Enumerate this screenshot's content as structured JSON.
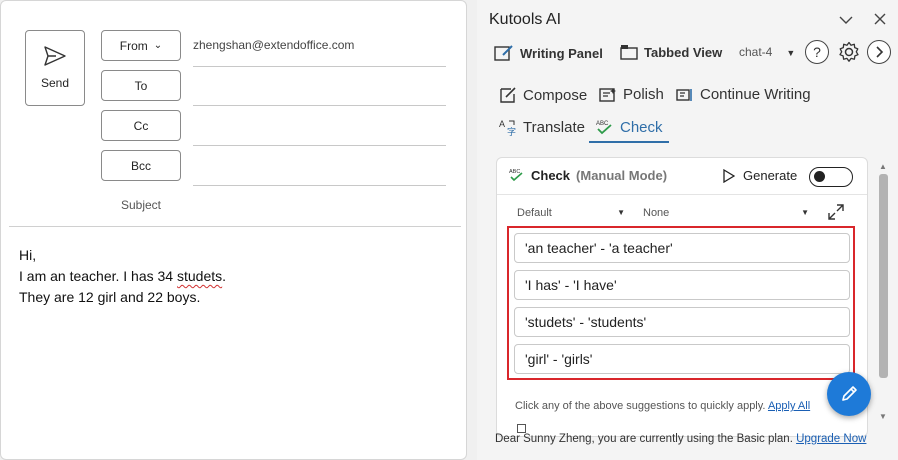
{
  "compose": {
    "send_label": "Send",
    "from_label": "From",
    "from_address": "zhengshan@extendoffice.com",
    "to_label": "To",
    "cc_label": "Cc",
    "bcc_label": "Bcc",
    "subject_label": "Subject",
    "body": {
      "line1": "Hi,",
      "line2_a": "I am an teacher. I has 34 ",
      "line2_misspelled": "studets",
      "line2_b": ".",
      "line3": "They are 12 girl and 22 boys."
    }
  },
  "pane": {
    "title": "Kutools AI",
    "toolbar": {
      "writing_panel": "Writing Panel",
      "tabbed_view": "Tabbed View",
      "chat_selector": "chat-4",
      "help": "?"
    },
    "tabs": {
      "compose": "Compose",
      "polish": "Polish",
      "continue_writing": "Continue Writing",
      "translate": "Translate",
      "check": "Check"
    },
    "check_card": {
      "icon_text": "ABC",
      "title": "Check",
      "mode": "(Manual Mode)",
      "generate": "Generate",
      "toggle_on": false,
      "select_style": "Default",
      "select_tone": "None",
      "suggestions": [
        "'an teacher' - 'a teacher'",
        "'I has' - 'I have'",
        "'studets' - 'students'",
        "'girl' - 'girls'"
      ],
      "hint": "Click any of the above suggestions to quickly apply.",
      "apply_all": "Apply All"
    },
    "footer": {
      "text": "Dear Sunny Zheng, you are currently using the Basic plan.",
      "upgrade": "Upgrade Now"
    }
  },
  "colors": {
    "accent": "#2f6ea8",
    "highlight_border": "#d9262b",
    "fab": "#1e7ad8",
    "link": "#1a5fb4"
  }
}
